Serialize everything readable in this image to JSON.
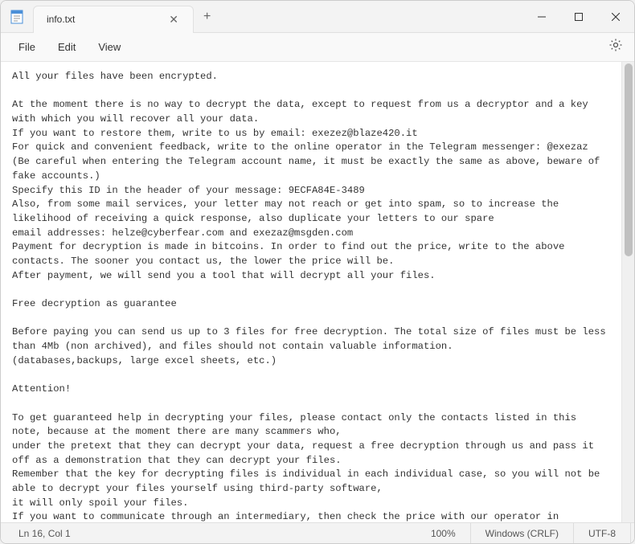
{
  "titlebar": {
    "tab_title": "info.txt"
  },
  "menubar": {
    "file": "File",
    "edit": "Edit",
    "view": "View"
  },
  "content": "All your files have been encrypted.\n\nAt the moment there is no way to decrypt the data, except to request from us a decryptor and a key with which you will recover all your data.\nIf you want to restore them, write to us by email: exezez@blaze420.it\nFor quick and convenient feedback, write to the online operator in the Telegram messenger: @exezaz\n(Be careful when entering the Telegram account name, it must be exactly the same as above, beware of fake accounts.)\nSpecify this ID in the header of your message: 9ECFA84E-3489\nAlso, from some mail services, your letter may not reach or get into spam, so to increase the likelihood of receiving a quick response, also duplicate your letters to our spare\nemail addresses: helze@cyberfear.com and exezaz@msgden.com\nPayment for decryption is made in bitcoins. In order to find out the price, write to the above contacts. The sooner you contact us, the lower the price will be.\nAfter payment, we will send you a tool that will decrypt all your files.\n\nFree decryption as guarantee\n\nBefore paying you can send us up to 3 files for free decryption. The total size of files must be less than 4Mb (non archived), and files should not contain valuable information.\n(databases,backups, large excel sheets, etc.)\n\nAttention!\n\nTo get guaranteed help in decrypting your files, please contact only the contacts listed in this note, because at the moment there are many scammers who,\nunder the pretext that they can decrypt your data, request a free decryption through us and pass it off as a demonstration that they can decrypt your files.\nRemember that the key for decrypting files is individual in each individual case, so you will not be able to decrypt your files yourself using third-party software,\nit will only spoil your files.\nIf you want to communicate through an intermediary, then check the price with our operator in advance, since intermediaries often wind up the real price.\n!!! When contacting third parties, we do not guarantee the decryption of your files!!!",
  "statusbar": {
    "position": "Ln 16, Col 1",
    "zoom": "100%",
    "line_ending": "Windows (CRLF)",
    "encoding": "UTF-8"
  }
}
